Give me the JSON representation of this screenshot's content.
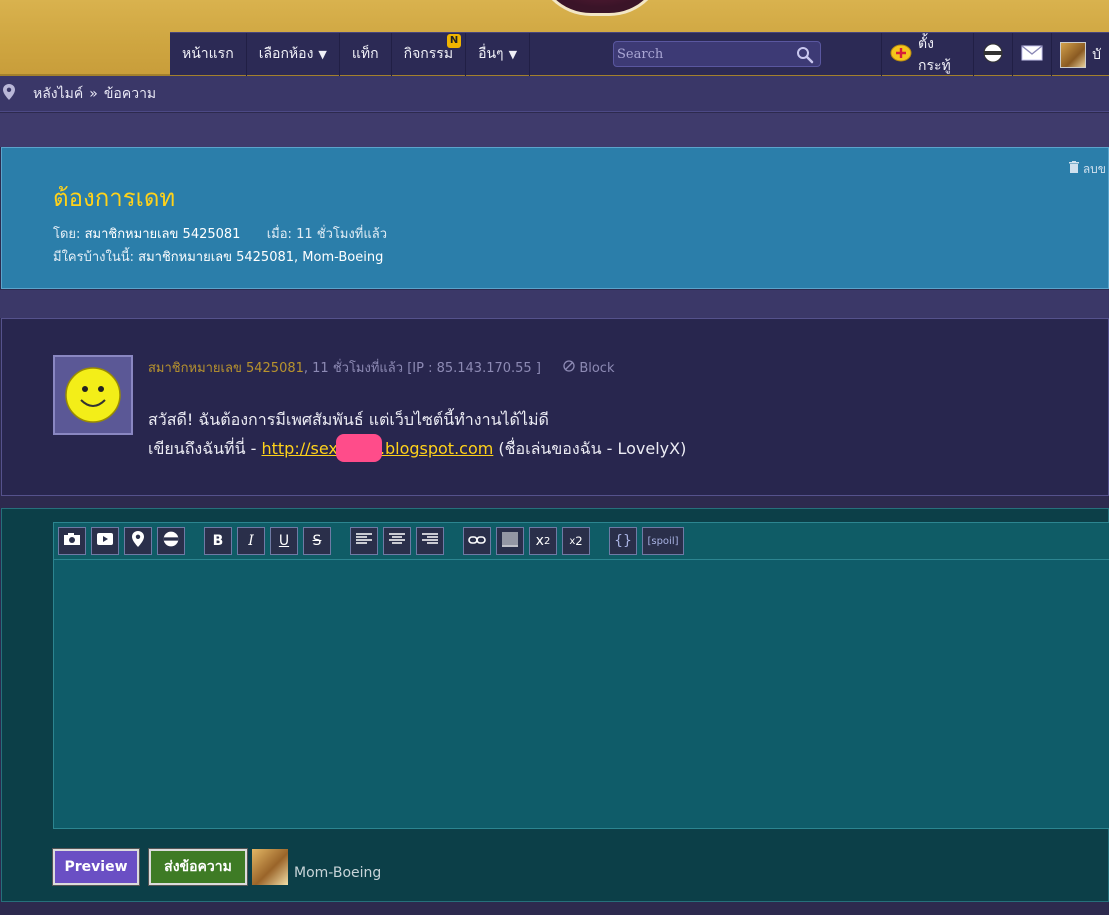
{
  "nav": {
    "items": [
      "หน้าแรก",
      "เลือกห้อง",
      "แท็ก",
      "กิจกรรม",
      "อื่นๆ"
    ],
    "activity_badge": "N",
    "search_placeholder": "Search",
    "post_topic_label": "ตั้งกระทู้",
    "profile_label": "บั"
  },
  "breadcrumb": {
    "root": "หลังไมค์",
    "separator": "»",
    "current": "ข้อความ"
  },
  "topic": {
    "title": "ต้องการเดท",
    "by_label": "โดย:",
    "author": "สมาชิกหมายเลข 5425081",
    "when_label": "เมื่อ:",
    "when": "11 ชั่วโมงที่แล้ว",
    "participants_label": "มีใครบ้างในนี้:",
    "participants": "สมาชิกหมายเลข 5425081, Mom-Boeing",
    "delete_label": "ลบข"
  },
  "post": {
    "author": "สมาชิกหมายเลข 5425081",
    "meta_rest": ", 11 ชั่วโมงที่แล้ว [IP : 85.143.170.55 ]",
    "block_label": "Block",
    "line1": "สวัสดี! ฉันต้องการมีเพศสัมพันธ์ แต่เว็บไซต์นี้ทำงานได้ไม่ดี",
    "line2_prefix": "เขียนถึงฉันที่นี่ - ",
    "link_start": "http://sex",
    "link_end": ".blogspot.com",
    "line2_suffix": " (ชื่อเล่นของฉัน - LovelyX)"
  },
  "reply": {
    "toolbar": {
      "bold": "B",
      "italic": "I",
      "underline": "U",
      "strike": "S",
      "superscript": "x",
      "superscript_exp": "2",
      "subscript": "x",
      "subscript_exp": "2",
      "code": "{}",
      "spoil": "[spoil]"
    },
    "preview_label": "Preview",
    "send_label": "ส่งข้อความ",
    "username": "Mom-Boeing"
  }
}
